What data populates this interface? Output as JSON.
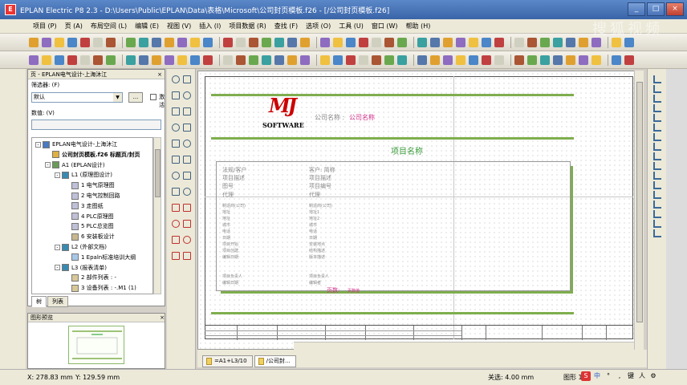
{
  "window": {
    "title": "EPLAN Electric P8 2.3 - D:\\Users\\Public\\EPLAN\\Data\\表格\\Microsoft\\公司封页模板.f26 - [/公司封页模板.f26]",
    "app_icon_text": "E",
    "watermark": "搜狐视频"
  },
  "menubar": {
    "items": [
      "项目 (P)",
      "页 (A)",
      "布局空间 (L)",
      "编辑 (E)",
      "视图 (V)",
      "插入 (I)",
      "项目数据 (R)",
      "查找 (F)",
      "选项 (O)",
      "工具 (U)",
      "窗口 (W)",
      "帮助 (H)"
    ]
  },
  "page_panel": {
    "title": "页 - EPLAN电气设计-上海沐江",
    "filter_label": "筛选器: (F)",
    "filter_value": "默认",
    "filter_button": "...",
    "activate_label": "激活",
    "value_label": "数值: (V)",
    "tree": [
      {
        "label": "EPLAN电气设计-上海沐江",
        "level": 0,
        "expander": "-",
        "icon": "project-icon"
      },
      {
        "label": "公司封页模板.f26 标题页/封页",
        "level": 1,
        "expander": "",
        "icon": "page-icon",
        "bold": true
      },
      {
        "label": "A1 (EPLAN设计)",
        "level": 1,
        "expander": "-",
        "icon": "structure-icon"
      },
      {
        "label": "L1 (原理图设计)",
        "level": 2,
        "expander": "-",
        "icon": "location-icon"
      },
      {
        "label": "1 电气原理图",
        "level": 3,
        "expander": "",
        "icon": "schematic-page-icon"
      },
      {
        "label": "2 电气控制回路",
        "level": 3,
        "expander": "",
        "icon": "schematic-page-icon"
      },
      {
        "label": "3 走图纸",
        "level": 3,
        "expander": "",
        "icon": "schematic-page-icon"
      },
      {
        "label": "4 PLC原理图",
        "level": 3,
        "expander": "",
        "icon": "schematic-page-icon"
      },
      {
        "label": "5 PLC总览图",
        "level": 3,
        "expander": "",
        "icon": "schematic-page-icon"
      },
      {
        "label": "6 安装板设计",
        "level": 3,
        "expander": "",
        "icon": "layout-page-icon"
      },
      {
        "label": "L2 (外部文档)",
        "level": 2,
        "expander": "-",
        "icon": "location-icon"
      },
      {
        "label": "1 Epaln标准培训大纲",
        "level": 3,
        "expander": "",
        "icon": "document-page-icon"
      },
      {
        "label": "L3 (报表清单)",
        "level": 2,
        "expander": "-",
        "icon": "location-icon"
      },
      {
        "label": "2 部件列表 : -",
        "level": 3,
        "expander": "",
        "icon": "report-page-icon"
      },
      {
        "label": "3 设备列表 : -.M1 (1)",
        "level": 3,
        "expander": "",
        "icon": "report-page-icon"
      }
    ],
    "tabs": [
      "树",
      "列表"
    ]
  },
  "preview_panel": {
    "title": "图形预览"
  },
  "drawing": {
    "logo_text": "MJ",
    "logo_sub": "SOFTWARE",
    "company_label": "公司名称 :",
    "company_value": "公司名称",
    "project_name": "项目名称",
    "left_fields": [
      "法规/客户",
      "项目描述",
      "图号",
      "代理"
    ],
    "right_fields": [
      "客户: 简称",
      "项目描述",
      "项目编号",
      "代理"
    ],
    "small_rows_left": [
      "制造商(公司)",
      "地址",
      "地址",
      "城市",
      "电话",
      "日期",
      "项目开始",
      "项目创建",
      "编辑日期",
      "",
      "",
      "项目负责人",
      "编辑日期"
    ],
    "small_rows_right": [
      "制造商(公司)",
      "地址1",
      "地址2",
      "城市",
      "电话",
      "日期",
      "安装地点",
      "结构描述",
      "版本描述",
      "",
      "",
      "项目负责人",
      "编辑者"
    ],
    "pages_label": "页数:",
    "pages_value": "页数值"
  },
  "page_tabs": [
    "=A1+L3/10",
    "/公司封..."
  ],
  "status": {
    "x": "X: 278.83 mm",
    "y": "Y: 129.59 mm",
    "grid": "关选: 4.00 mm",
    "graphic": "图形 1:1"
  },
  "ime": [
    "S",
    "中",
    "°",
    ",",
    "键",
    "人",
    "⚙"
  ]
}
